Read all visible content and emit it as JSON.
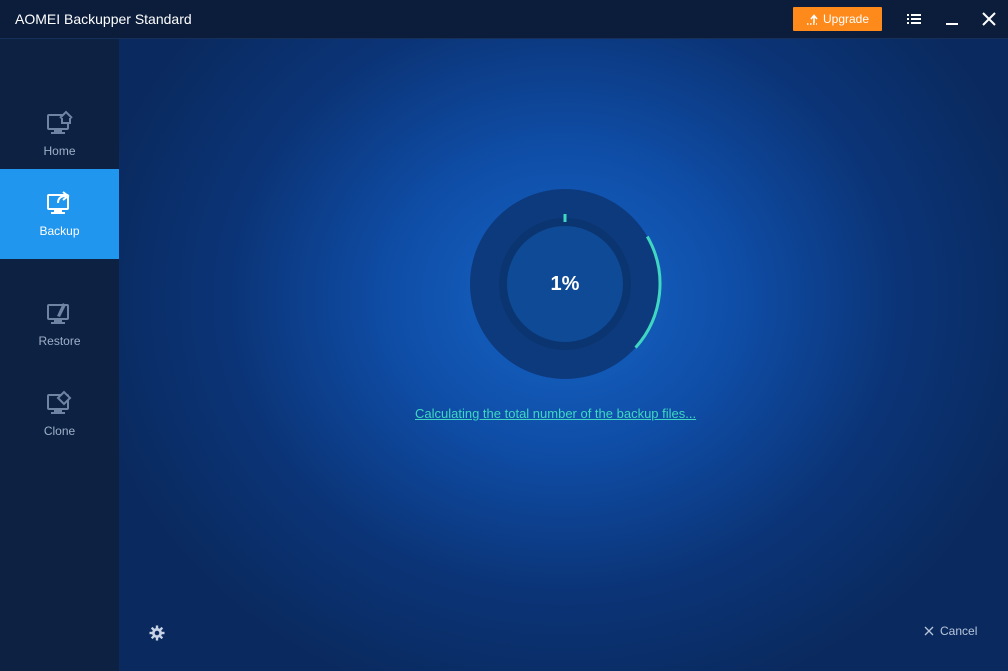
{
  "app": {
    "title": "AOMEI Backupper Standard"
  },
  "titlebar": {
    "upgrade_label": "Upgrade",
    "menu_icon": "menu-icon",
    "minimize_icon": "minimize-icon",
    "close_icon": "close-icon"
  },
  "sidebar": {
    "items": [
      {
        "label": "Home",
        "icon": "home-monitor-icon",
        "active": false
      },
      {
        "label": "Backup",
        "icon": "backup-monitor-icon",
        "active": true
      },
      {
        "label": "Restore",
        "icon": "restore-monitor-icon",
        "active": false
      },
      {
        "label": "Clone",
        "icon": "clone-monitor-icon",
        "active": false
      }
    ]
  },
  "progress": {
    "percent_text": "1%",
    "percent_value": 1,
    "status_text": "Calculating the total number of the backup files..."
  },
  "footer": {
    "settings_icon": "gear-icon",
    "cancel_label": "Cancel"
  },
  "colors": {
    "accent": "#2196ee",
    "upgrade": "#ff8a1c",
    "progress_ring": "#3fd6c2",
    "link": "#3fd6c2"
  }
}
